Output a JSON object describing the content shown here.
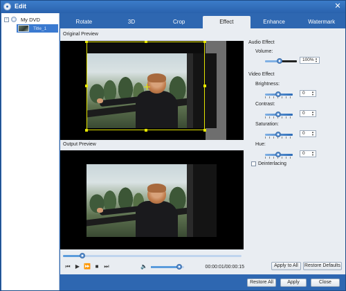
{
  "window": {
    "title": "Edit"
  },
  "tree": {
    "root_label": "My DVD",
    "expand_symbol": "⊟",
    "child_label": "Title_1"
  },
  "tabs": [
    {
      "label": "Rotate",
      "active": false
    },
    {
      "label": "3D",
      "active": false
    },
    {
      "label": "Crop",
      "active": false
    },
    {
      "label": "Effect",
      "active": true
    },
    {
      "label": "Enhance",
      "active": false
    },
    {
      "label": "Watermark",
      "active": false
    }
  ],
  "preview": {
    "original_label": "Original Preview",
    "output_label": "Output Preview"
  },
  "playback": {
    "seek_fraction": 0.11,
    "volume_fraction": 0.85,
    "timecode": "00:00:01/00:00:15"
  },
  "settings": {
    "audio_effect_label": "Audio Effect",
    "volume_label": "Volume:",
    "volume_value": "100%",
    "video_effect_label": "Video Effect",
    "brightness_label": "Brightness:",
    "brightness_value": "0",
    "contrast_label": "Contrast:",
    "contrast_value": "0",
    "saturation_label": "Saturation:",
    "saturation_value": "0",
    "hue_label": "Hue:",
    "hue_value": "0",
    "deinterlacing_label": "Deinterlacing",
    "deinterlacing_checked": false
  },
  "buttons": {
    "apply_to_all": "Apply to All",
    "restore_defaults": "Restore Defaults",
    "restore_all": "Restore All",
    "apply": "Apply",
    "close": "Close"
  },
  "colors": {
    "window_blue": "#2e67b1",
    "crop_yellow": "#e6e600",
    "selection_blue": "#3b7ad0"
  },
  "icons": {
    "close": "close-icon",
    "prev": "skip-back-icon",
    "play": "play-icon",
    "fast_forward": "fast-forward-icon",
    "stop": "stop-icon",
    "next": "skip-forward-icon",
    "volume": "speaker-icon"
  }
}
